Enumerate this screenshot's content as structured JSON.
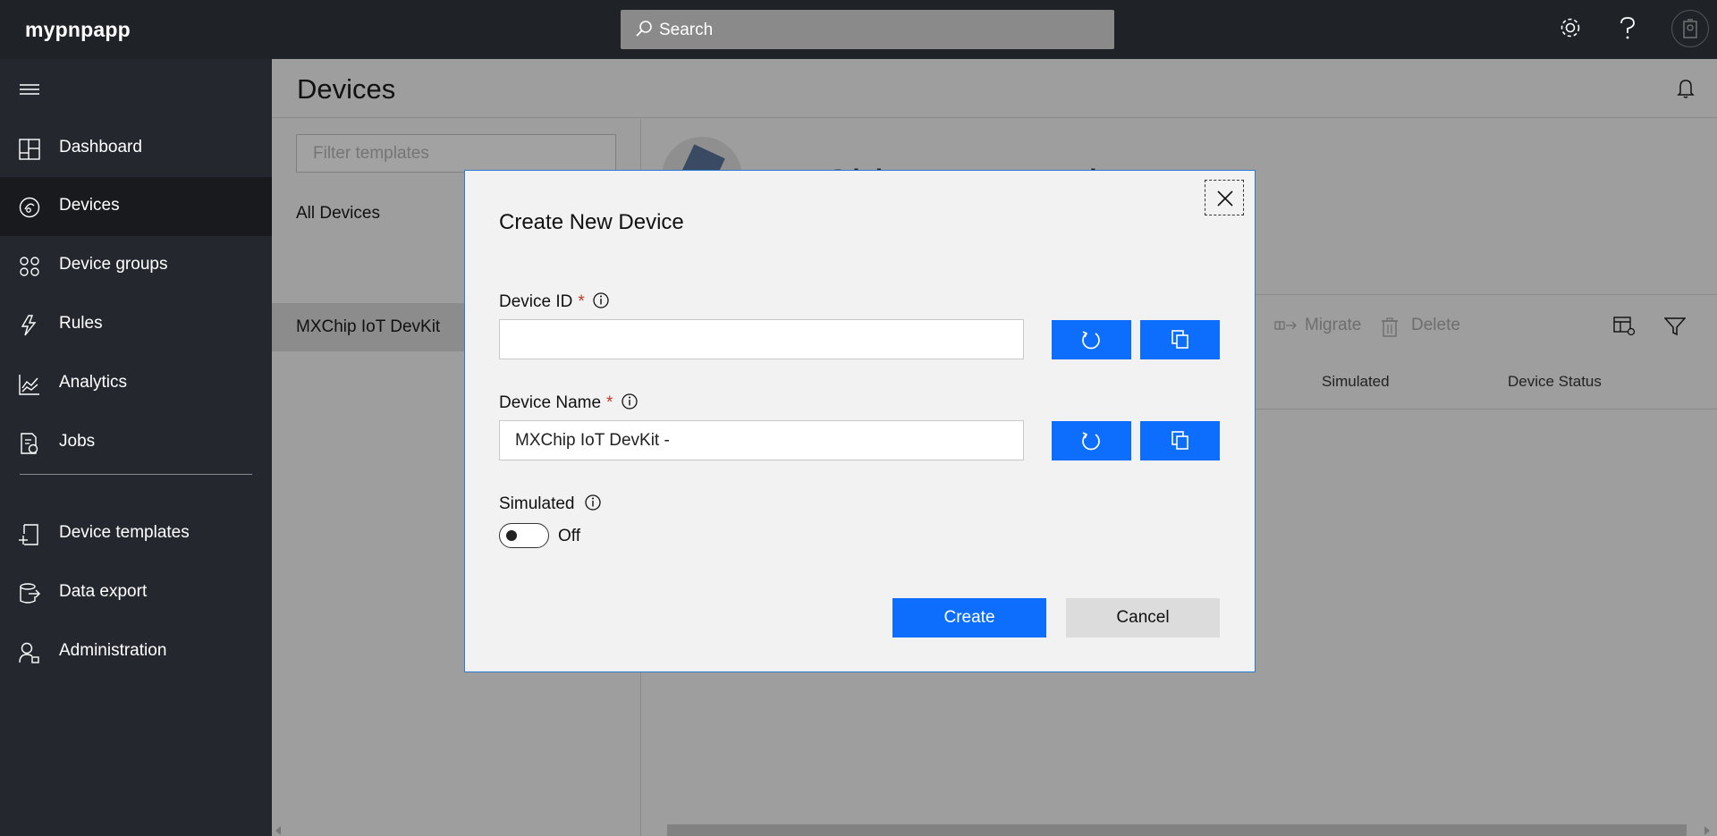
{
  "app": {
    "name": "mypnpapp"
  },
  "search": {
    "label": "Search"
  },
  "sidebar": {
    "items": [
      {
        "label": "Dashboard",
        "icon": "dashboard-icon"
      },
      {
        "label": "Devices",
        "icon": "devices-icon",
        "active": true
      },
      {
        "label": "Device groups",
        "icon": "device-groups-icon"
      },
      {
        "label": "Rules",
        "icon": "rules-icon"
      },
      {
        "label": "Analytics",
        "icon": "analytics-icon"
      },
      {
        "label": "Jobs",
        "icon": "jobs-icon"
      },
      {
        "label": "Device templates",
        "icon": "device-templates-icon"
      },
      {
        "label": "Data export",
        "icon": "data-export-icon"
      },
      {
        "label": "Administration",
        "icon": "administration-icon"
      }
    ]
  },
  "page": {
    "title": "Devices",
    "filter_placeholder": "Filter templates",
    "templates": [
      "All Devices",
      "MXChip IoT DevKit"
    ],
    "template_heading": "MXChip IoT DevKit",
    "toolbar": {
      "migrate": "Migrate",
      "delete": "Delete"
    },
    "columns": {
      "simulated": "Simulated",
      "device_status": "Device Status"
    }
  },
  "modal": {
    "title": "Create New Device",
    "device_id": {
      "label": "Device ID",
      "required": "*",
      "value": ""
    },
    "device_name": {
      "label": "Device Name",
      "required": "*",
      "value": "MXChip IoT DevKit -"
    },
    "simulated": {
      "label": "Simulated",
      "state": "Off"
    },
    "create_label": "Create",
    "cancel_label": "Cancel"
  },
  "colors": {
    "accent": "#0d6efd",
    "topbar": "#1f2328",
    "sidebar": "#24282e",
    "required": "#c0392b"
  }
}
